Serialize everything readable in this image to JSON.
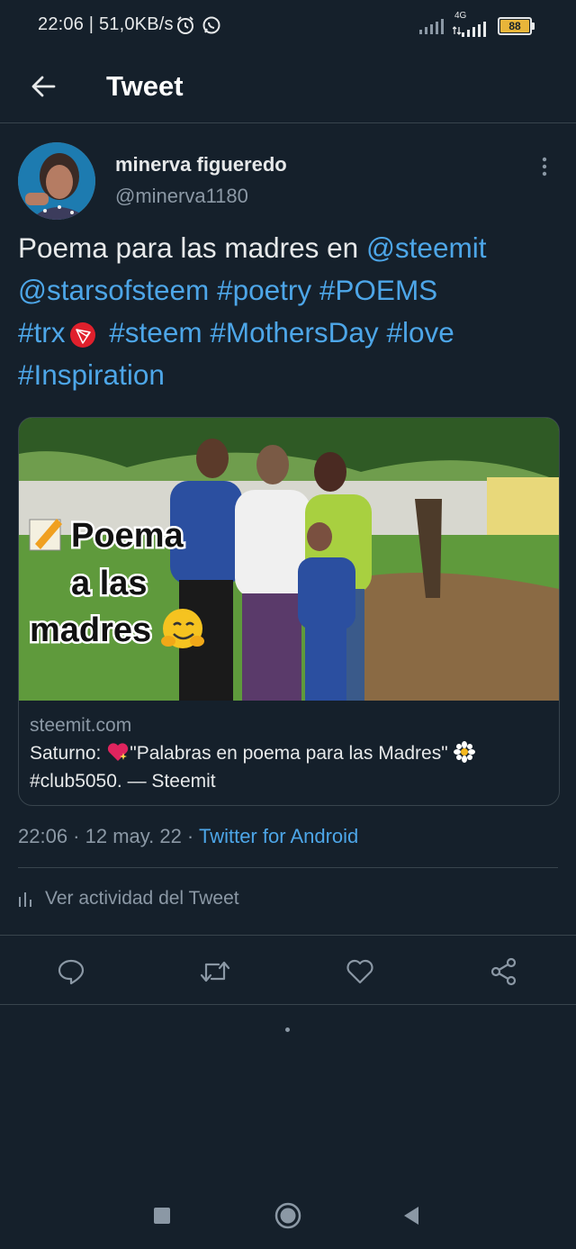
{
  "status_bar": {
    "time_speed": "22:06 | 51,0KB/s",
    "network": "4G",
    "battery": "88",
    "battery_color": "#e8b53a"
  },
  "header": {
    "title": "Tweet",
    "back_icon": "arrow-left-icon"
  },
  "tweet": {
    "author_name": "minerva figueredo",
    "author_handle": "@minerva1180",
    "text": {
      "plain1": "Poema para las madres en ",
      "link1": "@steemit",
      "link2": "@starsofsteem",
      "link3": "#poetry",
      "link4": "#POEMS",
      "link5": "#trx",
      "link6": "#steem",
      "link7": "#MothersDay",
      "link8": "#love",
      "link9": "#Inspiration"
    },
    "card": {
      "overlay_line1": "Poema",
      "overlay_line2": "a las",
      "overlay_line3": "madres",
      "domain": "steemit.com",
      "title_part1": "Saturno: ",
      "title_part2": "\"Palabras en poema para las Madres\" ",
      "title_part3": "#club5050. — Steemit"
    },
    "timestamp": "22:06 · 12 may. 22 · ",
    "source": "Twitter for Android",
    "activity_label": "Ver actividad del Tweet"
  },
  "actions": [
    "reply-icon",
    "retweet-icon",
    "like-icon",
    "share-icon"
  ],
  "colors": {
    "background": "#15202b",
    "link": "#4da6e8",
    "secondary_text": "#8b98a5",
    "divider": "#38444d"
  }
}
